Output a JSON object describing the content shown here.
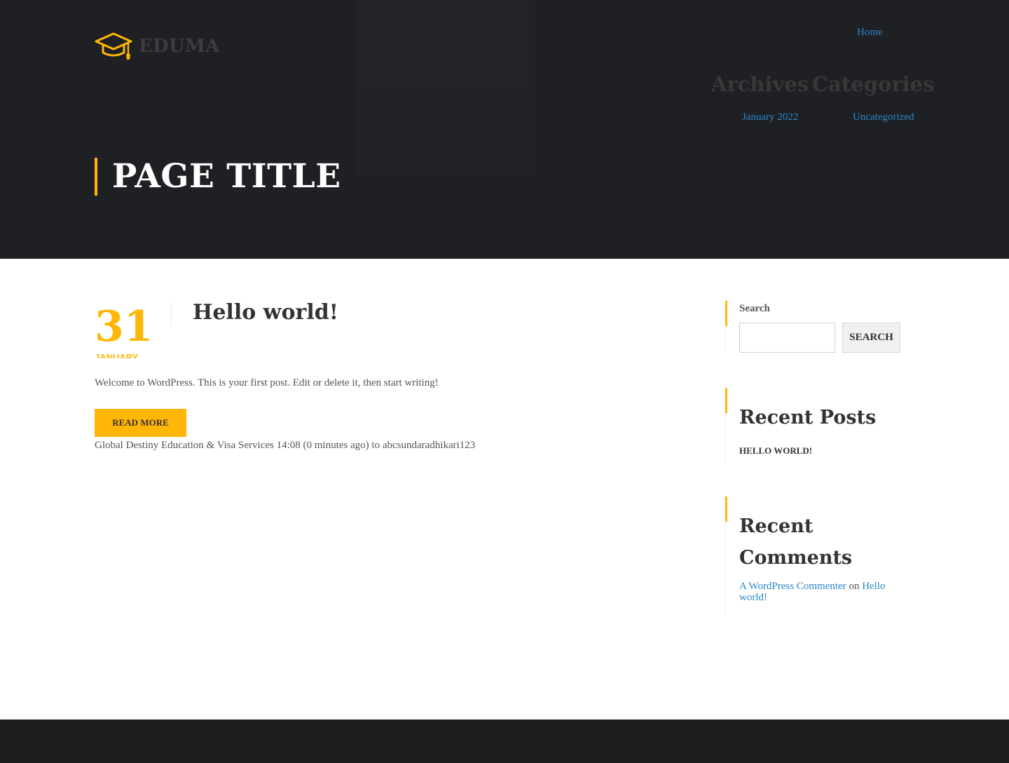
{
  "header": {
    "logo_text": "EDUMA",
    "nav": {
      "home": "Home"
    }
  },
  "hero_widgets": {
    "archives": {
      "title": "Archives",
      "items": [
        "January 2022"
      ]
    },
    "categories": {
      "title": "Categories",
      "items": [
        "Uncategorized"
      ]
    }
  },
  "page_title": "PAGE TITLE",
  "post": {
    "day": "31",
    "month": "JANUARY",
    "title": "Hello world!",
    "excerpt": "Welcome to WordPress. This is your first post. Edit or delete it, then start writing!",
    "read_more": "READ MORE",
    "meta": "Global Destiny Education & Visa Services 14:08 (0 minutes ago) to abcsundaradhikari123"
  },
  "sidebar": {
    "search": {
      "label": "Search",
      "button": "SEARCH",
      "value": ""
    },
    "recent_posts": {
      "title": "Recent Posts",
      "items": [
        "HELLO WORLD!"
      ]
    },
    "recent_comments": {
      "title": "Recent Comments",
      "author": "A WordPress Commenter",
      "on": "on",
      "post": "Hello world!"
    }
  },
  "colors": {
    "accent": "#ffb606",
    "link": "#2a86c9",
    "hero_bg": "#1e2024",
    "footer_bg": "#1e1e1e"
  },
  "icons": {
    "logo": "graduation-cap-icon"
  }
}
